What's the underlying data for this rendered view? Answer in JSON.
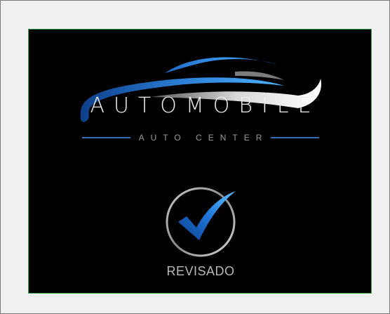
{
  "brand": {
    "name": "AUTOMOBILE",
    "tagline": "AUTO CENTER",
    "accent_color": "#2e86de",
    "logo_icon": "car-silhouette-swoosh"
  },
  "status": {
    "label": "REVISADO",
    "icon": "checkmark-circle-icon",
    "color": "#2e86de"
  },
  "colors": {
    "background": "#000000",
    "frame_border": "#3fa85a",
    "text_primary": "#eeeeee",
    "text_secondary": "#9a9a9a"
  }
}
